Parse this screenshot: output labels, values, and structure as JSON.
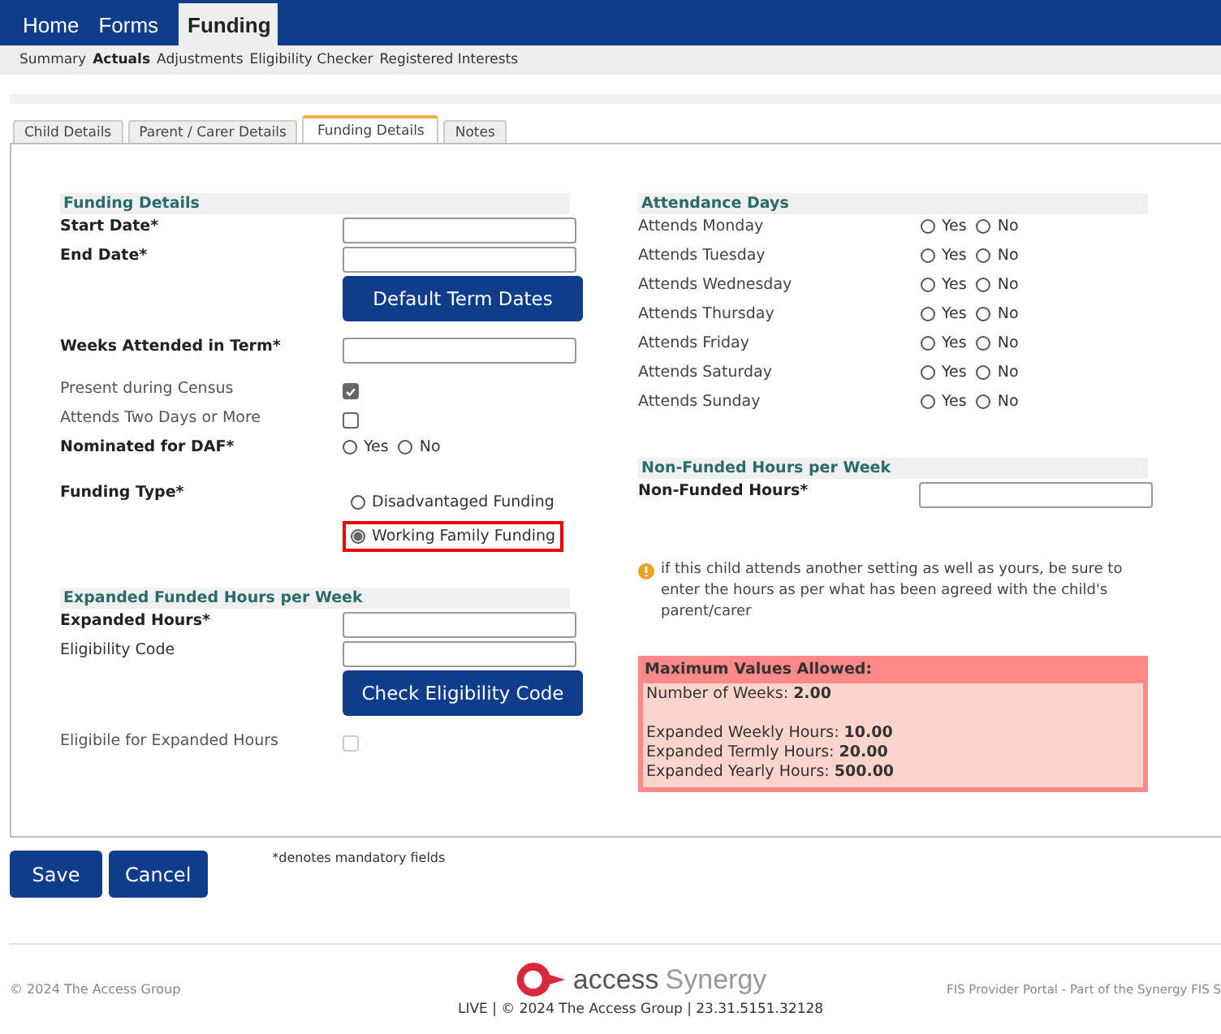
{
  "nav": [
    {
      "label": "Home",
      "selected": false
    },
    {
      "label": "Forms",
      "selected": false
    },
    {
      "label": "Funding",
      "selected": true
    }
  ],
  "subnav": [
    {
      "label": "Summary",
      "selected": false
    },
    {
      "label": "Actuals",
      "selected": true
    },
    {
      "label": "Adjustments",
      "selected": false
    },
    {
      "label": "Eligibility Checker",
      "selected": false
    },
    {
      "label": "Registered Interests",
      "selected": false
    }
  ],
  "tabs": [
    {
      "label": "Child Details",
      "selected": false
    },
    {
      "label": "Parent / Carer Details",
      "selected": false
    },
    {
      "label": "Funding Details",
      "selected": true
    },
    {
      "label": "Notes",
      "selected": false
    }
  ],
  "left_sections": [
    {
      "title": "Funding Details",
      "rows": [
        {
          "kind": "input",
          "label": "Start Date*",
          "required": true
        },
        {
          "kind": "input",
          "label": "End Date*",
          "required": true
        },
        {
          "kind": "button",
          "label": "Default Term Dates"
        },
        {
          "kind": "input",
          "label": "Weeks Attended in Term*",
          "required": true
        },
        {
          "kind": "checkbox",
          "label": "Present during Census",
          "required": false,
          "checked": true,
          "disabled": false
        },
        {
          "kind": "checkbox",
          "label": "Attends Two Days or More",
          "required": false,
          "checked": false,
          "disabled": false
        },
        {
          "kind": "radio",
          "label": "Nominated for DAF*",
          "required": true,
          "options": [
            {
              "label": "Yes",
              "selected": false
            },
            {
              "label": "No",
              "selected": false
            }
          ]
        },
        {
          "kind": "radiostack",
          "label": "Funding Type*",
          "required": true,
          "options": [
            {
              "label": "Disadvantaged Funding",
              "selected": false,
              "highlighted": false
            },
            {
              "label": "Working Family Funding",
              "selected": true,
              "highlighted": true
            }
          ]
        }
      ]
    },
    {
      "title": "Expanded Funded Hours per Week",
      "rows": [
        {
          "kind": "input",
          "label": "Expanded Hours*",
          "required": true
        },
        {
          "kind": "input",
          "label": "Eligibility Code",
          "required": false
        },
        {
          "kind": "button",
          "label": "Check Eligibility Code"
        },
        {
          "kind": "checkbox",
          "label": "Eligibile for Expanded Hours",
          "required": false,
          "checked": false,
          "disabled": true
        }
      ]
    }
  ],
  "attendance": {
    "title": "Attendance Days",
    "rows": [
      {
        "label": "Attends Monday",
        "options": [
          {
            "label": "Yes",
            "selected": false
          },
          {
            "label": "No",
            "selected": false
          }
        ]
      },
      {
        "label": "Attends Tuesday",
        "options": [
          {
            "label": "Yes",
            "selected": false
          },
          {
            "label": "No",
            "selected": false
          }
        ]
      },
      {
        "label": "Attends Wednesday",
        "options": [
          {
            "label": "Yes",
            "selected": false
          },
          {
            "label": "No",
            "selected": false
          }
        ]
      },
      {
        "label": "Attends Thursday",
        "options": [
          {
            "label": "Yes",
            "selected": false
          },
          {
            "label": "No",
            "selected": false
          }
        ]
      },
      {
        "label": "Attends Friday",
        "options": [
          {
            "label": "Yes",
            "selected": false
          },
          {
            "label": "No",
            "selected": false
          }
        ]
      },
      {
        "label": "Attends Saturday",
        "options": [
          {
            "label": "Yes",
            "selected": false
          },
          {
            "label": "No",
            "selected": false
          }
        ]
      },
      {
        "label": "Attends Sunday",
        "options": [
          {
            "label": "Yes",
            "selected": false
          },
          {
            "label": "No",
            "selected": false
          }
        ]
      }
    ]
  },
  "non_funded": {
    "title": "Non-Funded Hours per Week",
    "label": "Non-Funded Hours*"
  },
  "note": "if this child attends another setting as well as yours, be sure to enter the hours as per what has been agreed with the child's parent/carer",
  "max_values": {
    "title": "Maximum Values Allowed:",
    "groups": [
      [
        {
          "label": "Number of Weeks:",
          "value": "2.00"
        }
      ],
      [
        {
          "label": "Expanded Weekly Hours:",
          "value": "10.00"
        },
        {
          "label": "Expanded Termly Hours:",
          "value": "20.00"
        },
        {
          "label": "Expanded Yearly Hours:",
          "value": "500.00"
        }
      ]
    ]
  },
  "buttons": [
    {
      "label": "Save"
    },
    {
      "label": "Cancel"
    }
  ],
  "mandatory_note": "*denotes mandatory fields",
  "footer": {
    "left": "© 2024 The Access Group",
    "logo_word_1": "access",
    "logo_word_2": "Synergy",
    "version": "LIVE | © 2024 The Access Group | 23.31.5151.32128",
    "right": "FIS Provider Portal - Part of the Synergy FIS S"
  }
}
